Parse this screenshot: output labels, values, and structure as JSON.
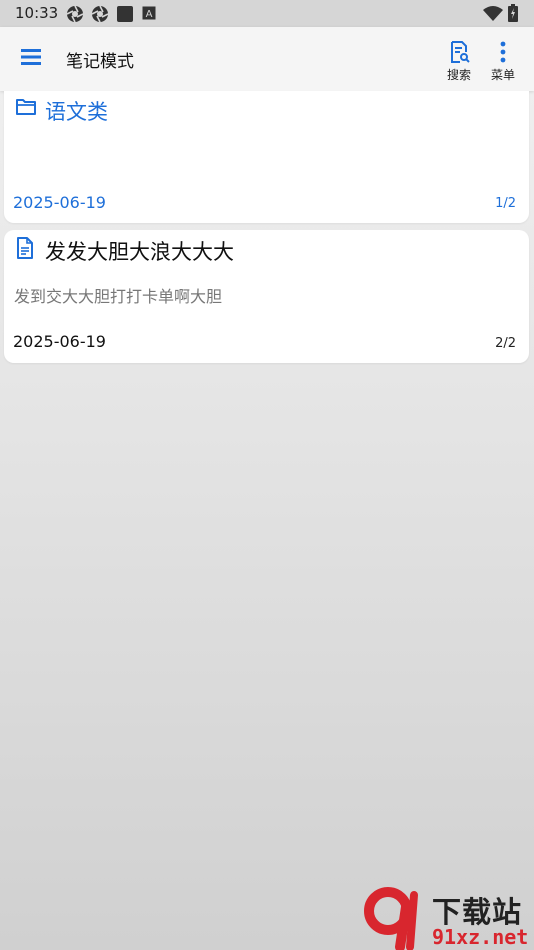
{
  "status_bar": {
    "time": "10:33",
    "icons": [
      "sync-icon",
      "sync-icon",
      "square-icon",
      "keyboard-a-icon",
      "wifi-icon",
      "battery-icon"
    ]
  },
  "app_bar": {
    "title": "笔记模式",
    "actions": [
      {
        "label": "搜索",
        "icon": "search-note-icon"
      },
      {
        "label": "菜单",
        "icon": "more-vertical-icon"
      }
    ]
  },
  "notes": [
    {
      "type": "folder",
      "icon": "folder-icon",
      "title": "语文类",
      "preview": "",
      "date": "2025-06-19",
      "page": "1/2"
    },
    {
      "type": "note",
      "icon": "document-icon",
      "title": "发发大胆大浪大大大",
      "preview": "发到交大大胆打打卡单啊大胆",
      "date": "2025-06-19",
      "page": "2/2"
    }
  ],
  "watermark": {
    "top": "下载站",
    "bottom": "91xz.net"
  },
  "colors": {
    "accent": "#1e6fd9",
    "watermark_red": "#d8262e"
  }
}
